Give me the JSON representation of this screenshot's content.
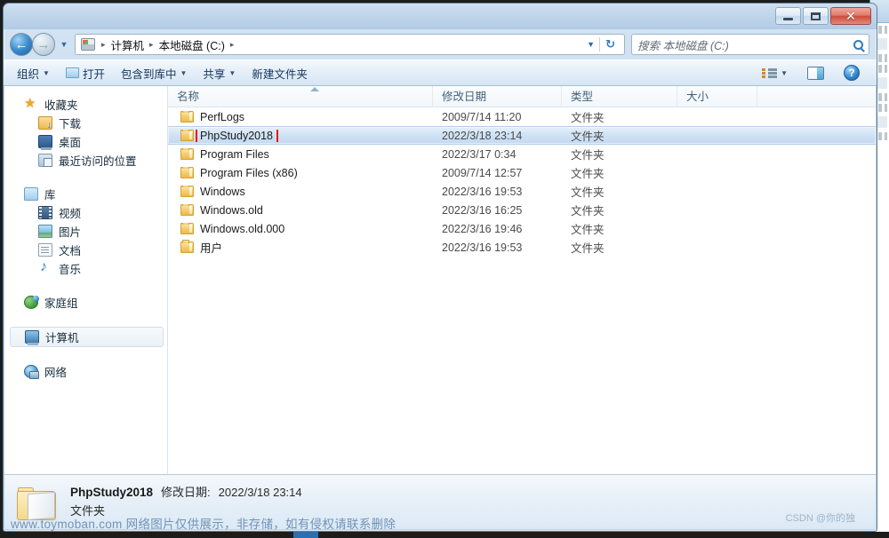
{
  "window": {
    "controls": {
      "minimize": "─",
      "maximize": "□",
      "close": "✕"
    }
  },
  "navigation": {
    "back_label": "←",
    "forward_label": "→",
    "history_caret": "▼",
    "refresh_label": "↻",
    "breadcrumbs": [
      "计算机",
      "本地磁盘 (C:)"
    ],
    "separator": "▸",
    "address_caret": "▼"
  },
  "search": {
    "placeholder": "搜索 本地磁盘 (C:)"
  },
  "toolbar": {
    "organize": "组织",
    "open": "打开",
    "include_in_library": "包含到库中",
    "share": "共享",
    "new_folder": "新建文件夹",
    "caret": "▼",
    "help": "?"
  },
  "sidebar": {
    "groups": [
      {
        "header": {
          "label": "收藏夹",
          "icon": "star-icon"
        },
        "items": [
          {
            "label": "下载",
            "icon": "downloads-icon"
          },
          {
            "label": "桌面",
            "icon": "desktop-icon"
          },
          {
            "label": "最近访问的位置",
            "icon": "recent-places-icon"
          }
        ]
      },
      {
        "header": {
          "label": "库",
          "icon": "library-icon"
        },
        "items": [
          {
            "label": "视频",
            "icon": "video-icon"
          },
          {
            "label": "图片",
            "icon": "pictures-icon"
          },
          {
            "label": "文档",
            "icon": "documents-icon"
          },
          {
            "label": "音乐",
            "icon": "music-icon"
          }
        ]
      },
      {
        "header": {
          "label": "家庭组",
          "icon": "homegroup-icon"
        },
        "items": []
      },
      {
        "header": {
          "label": "计算机",
          "icon": "computer-icon",
          "selected": true
        },
        "items": []
      },
      {
        "header": {
          "label": "网络",
          "icon": "network-icon"
        },
        "items": []
      }
    ]
  },
  "file_list": {
    "columns": [
      {
        "key": "name",
        "label": "名称",
        "sorted": true
      },
      {
        "key": "date",
        "label": "修改日期"
      },
      {
        "key": "type",
        "label": "类型"
      },
      {
        "key": "size",
        "label": "大小"
      }
    ],
    "rows": [
      {
        "name": "PerfLogs",
        "date": "2009/7/14 11:20",
        "type": "文件夹",
        "size": "",
        "selected": false,
        "annotated": false
      },
      {
        "name": "PhpStudy2018",
        "date": "2022/3/18 23:14",
        "type": "文件夹",
        "size": "",
        "selected": true,
        "annotated": true
      },
      {
        "name": "Program Files",
        "date": "2022/3/17 0:34",
        "type": "文件夹",
        "size": "",
        "selected": false,
        "annotated": false
      },
      {
        "name": "Program Files (x86)",
        "date": "2009/7/14 12:57",
        "type": "文件夹",
        "size": "",
        "selected": false,
        "annotated": false
      },
      {
        "name": "Windows",
        "date": "2022/3/16 19:53",
        "type": "文件夹",
        "size": "",
        "selected": false,
        "annotated": false
      },
      {
        "name": "Windows.old",
        "date": "2022/3/16 16:25",
        "type": "文件夹",
        "size": "",
        "selected": false,
        "annotated": false
      },
      {
        "name": "Windows.old.000",
        "date": "2022/3/16 19:46",
        "type": "文件夹",
        "size": "",
        "selected": false,
        "annotated": false
      },
      {
        "name": "用户",
        "date": "2022/3/16 19:53",
        "type": "文件夹",
        "size": "",
        "selected": false,
        "annotated": false
      }
    ]
  },
  "details_pane": {
    "name": "PhpStudy2018",
    "date_label": "修改日期:",
    "date_value": "2022/3/18 23:14",
    "type": "文件夹"
  },
  "watermarks": {
    "bottom": "www.toymoban.com 网络图片仅供展示，非存储，如有侵权请联系删除",
    "corner": "CSDN @你的独"
  },
  "colors": {
    "selection_blue": "#c3d9f1",
    "annotation_red": "#ee1111",
    "close_red": "#cf4c3b",
    "accent_blue": "#2f7bc0"
  }
}
